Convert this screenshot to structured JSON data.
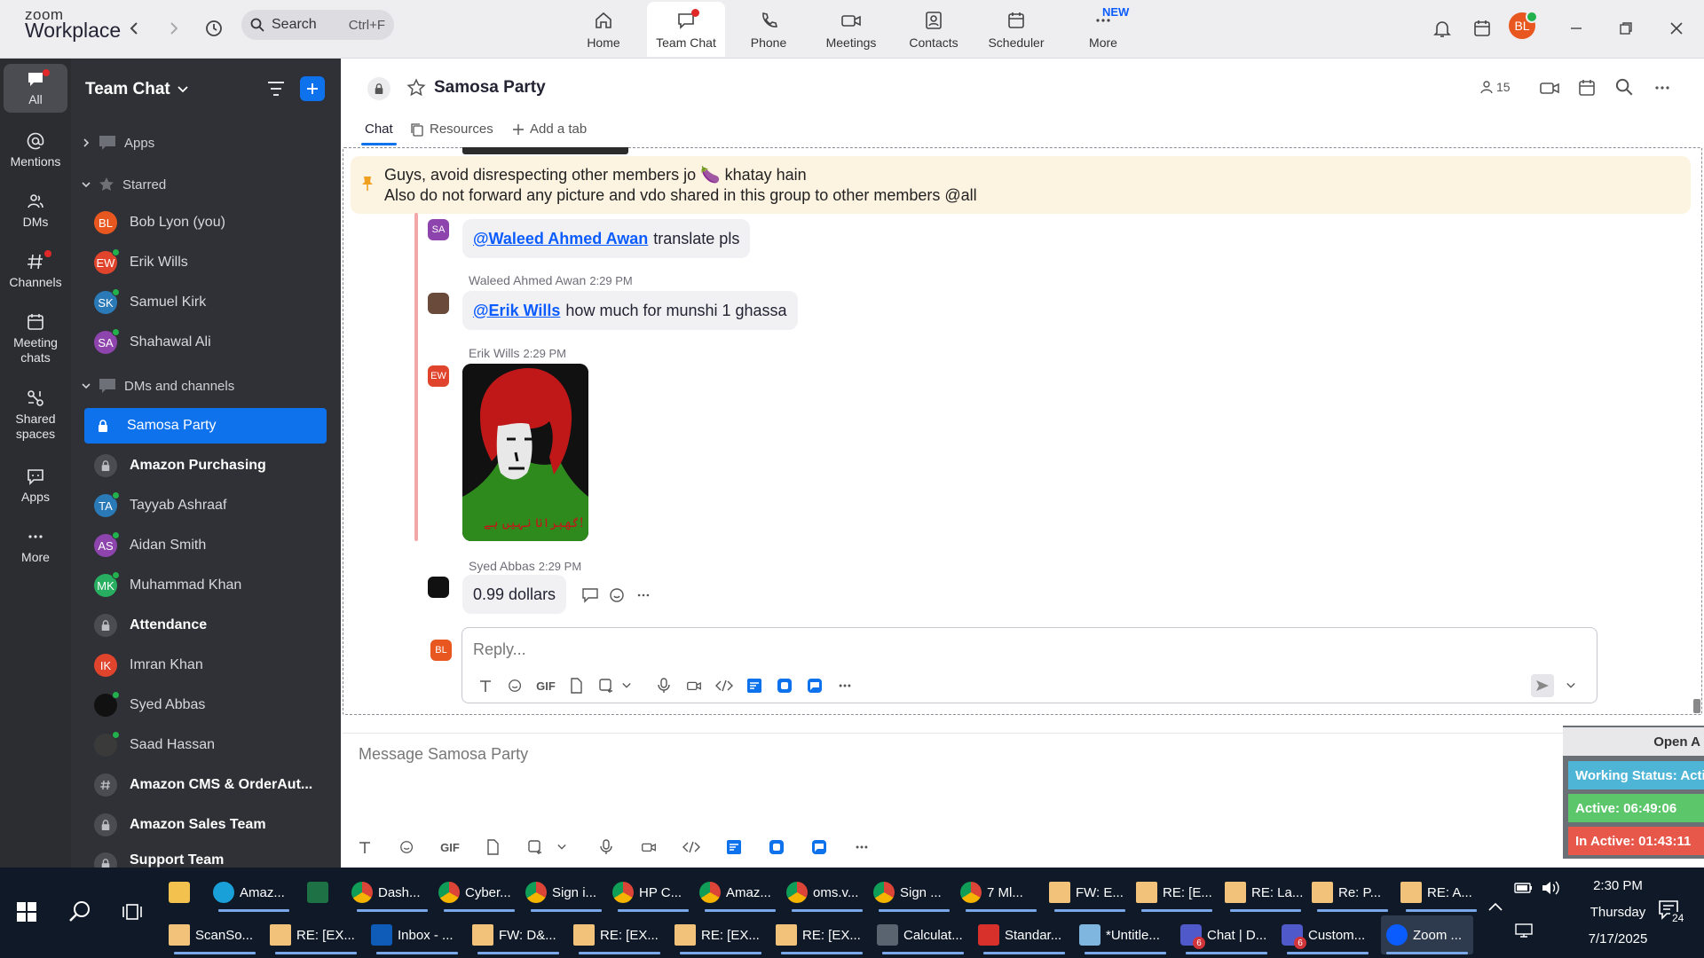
{
  "topbar": {
    "logo_line1": "zoom",
    "logo_line2": "Workplace",
    "search_label": "Search",
    "search_shortcut": "Ctrl+F",
    "nav": [
      {
        "label": "Home",
        "icon": "home-icon"
      },
      {
        "label": "Team Chat",
        "icon": "chat-icon",
        "active": true
      },
      {
        "label": "Phone",
        "icon": "phone-icon"
      },
      {
        "label": "Meetings",
        "icon": "video-icon"
      },
      {
        "label": "Contacts",
        "icon": "contacts-icon"
      },
      {
        "label": "Scheduler",
        "icon": "calendar-icon"
      },
      {
        "label": "More",
        "icon": "more-icon",
        "badge": "NEW"
      }
    ],
    "avatar_initials": "BL"
  },
  "rail": [
    {
      "label": "All",
      "icon": "chat-bubble-icon",
      "active": true
    },
    {
      "label": "Mentions",
      "icon": "at-icon"
    },
    {
      "label": "DMs",
      "icon": "people-icon"
    },
    {
      "label": "Channels",
      "icon": "hash-icon"
    },
    {
      "label": "Meeting chats",
      "icon": "calendar-icon"
    },
    {
      "label": "Shared spaces",
      "icon": "shared-icon"
    },
    {
      "label": "Apps",
      "icon": "apps-icon"
    },
    {
      "label": "More",
      "icon": "ellipsis-icon"
    }
  ],
  "sidebar": {
    "title": "Team Chat",
    "apps_label": "Apps",
    "starred_label": "Starred",
    "starred": [
      {
        "name": "Bob Lyon (you)",
        "initials": "BL",
        "color": "#e8571f"
      },
      {
        "name": "Erik Wills",
        "initials": "EW",
        "color": "#e0442c"
      },
      {
        "name": "Samuel Kirk",
        "initials": "SK",
        "color": "#2a7ab8"
      },
      {
        "name": "Shahawal Ali",
        "initials": "SA",
        "color": "#8e44ad"
      }
    ],
    "dms_label": "DMs and channels",
    "dms": [
      {
        "name": "Samosa Party",
        "type": "lock",
        "selected": true
      },
      {
        "name": "Amazon Purchasing",
        "type": "lock",
        "bold": true
      },
      {
        "name": "Tayyab Ashraaf",
        "initials": "TA",
        "color": "#2a7ab8"
      },
      {
        "name": "Aidan Smith",
        "initials": "AS",
        "color": "#8e44ad"
      },
      {
        "name": "Muhammad Khan",
        "initials": "MK",
        "color": "#27ae60"
      },
      {
        "name": "Attendance",
        "type": "lock",
        "bold": true
      },
      {
        "name": "Imran Khan",
        "initials": "IK",
        "color": "#e0442c"
      },
      {
        "name": "Syed Abbas",
        "initials": "",
        "color": "#111111"
      },
      {
        "name": "Saad Hassan",
        "initials": "",
        "color": "#3a3a3a"
      },
      {
        "name": "Amazon CMS & OrderAut...",
        "type": "hash",
        "bold": true
      },
      {
        "name": "Amazon Sales Team",
        "type": "lock",
        "bold": true
      },
      {
        "name": "Support Team",
        "type": "lock",
        "bold": true
      }
    ]
  },
  "channel": {
    "name": "Samosa Party",
    "member_count": "15",
    "tabs": {
      "chat": "Chat",
      "resources": "Resources",
      "add": "Add a tab"
    }
  },
  "pinned": {
    "line1": "Guys, avoid disrespecting other members jo 🍆 khatay hain",
    "line2": "Also do not forward any picture and vdo shared in this group to other members @all"
  },
  "messages": [
    {
      "sender": "",
      "initials": "SA",
      "mention": "@Waleed Ahmed Awan",
      "text": "translate pls"
    },
    {
      "sender": "Waleed Ahmed Awan",
      "time": "2:29 PM",
      "mention": "@Erik Wills",
      "text": "how much for munshi 1 ghassa"
    },
    {
      "sender": "Erik Wills",
      "time": "2:29 PM",
      "initials": "EW",
      "image_caption": "گھبرانا نہیں ہے!"
    },
    {
      "sender": "Syed Abbas",
      "time": "2:29 PM",
      "text": "0.99 dollars"
    }
  ],
  "reply": {
    "placeholder": "Reply...",
    "avatar": "BL",
    "gif": "GIF"
  },
  "composer": {
    "placeholder": "Message Samosa Party",
    "gif": "GIF"
  },
  "widget": {
    "header": "Open A",
    "status": "Working Status: Acti",
    "active": "Active: 06:49:06",
    "inactive": "In Active: 01:43:11"
  },
  "taskbar": {
    "row1": [
      "Amaz...",
      "Dash...",
      "Cyber...",
      "Sign i...",
      "HP C...",
      "Amaz...",
      "oms.v...",
      "Sign ...",
      "7 Ml...",
      "FW: E...",
      "RE: [E...",
      "RE: La...",
      "Re: P...",
      "RE: A..."
    ],
    "row2": [
      "ScanSo...",
      "RE: [EX...",
      "Inbox - ...",
      "FW: D&...",
      "RE: [EX...",
      "RE: [EX...",
      "RE: [EX...",
      "Calculat...",
      "Standar...",
      "*Untitle...",
      "Chat | D...",
      "Custom...",
      "Zoom ..."
    ],
    "time": "2:30 PM",
    "day": "Thursday",
    "date": "7/17/2025",
    "notif_count": "24"
  }
}
